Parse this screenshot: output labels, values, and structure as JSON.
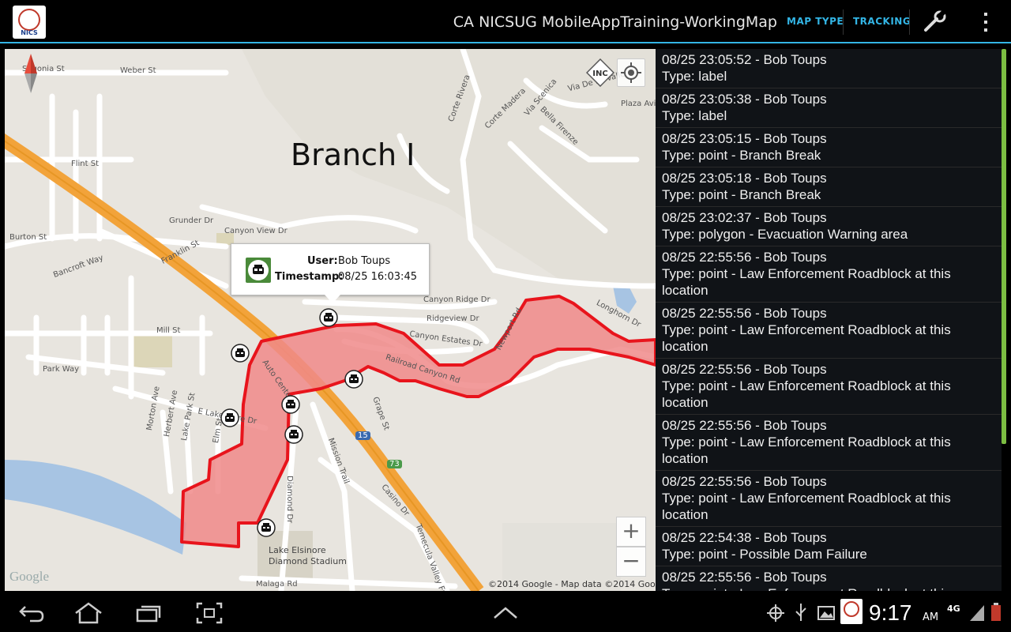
{
  "header": {
    "app_logo_text": "NICS",
    "title": "CA NICSUG MobileAppTraining-WorkingMap",
    "map_type_label": "MAP TYPE",
    "tracking_label": "TRACKING"
  },
  "map": {
    "branch_label": "Branch I",
    "inc_label": "INC",
    "zoom_in": "+",
    "zoom_out": "−",
    "google": "Google",
    "copyright": "©2014 Google - Map data ©2014 Google",
    "stadium": "Lake Elsinore\nDiamond Stadium",
    "streets": {
      "weber": "Weber St",
      "segonia": "Segonia St",
      "flint": "Flint St",
      "burton": "Burton St",
      "bancroft": "Bancroft Way",
      "franklin": "Franklin St",
      "grunder": "Grunder Dr",
      "canyon_view": "Canyon View Dr",
      "mill": "Mill St",
      "park_way": "Park Way",
      "e_lakeshore": "E Lakeshore Dr",
      "morton": "Morton Ave",
      "herbert": "Herbert Ave",
      "lake_park": "Lake Park St",
      "elm": "Elm St",
      "canyon_ridge": "Canyon Ridge Dr",
      "ridgeview": "Ridgeview Dr",
      "canyon_estates": "Canyon Estates Dr",
      "railroad": "Railroad Canyon Rd",
      "newport": "Newport Rd",
      "longhorn": "Longhorn Dr",
      "grape": "Grape St",
      "mission": "Mission Trail",
      "casino": "Casino Dr",
      "diamond": "Diamond Dr",
      "malaga": "Malaga Rd",
      "temecula": "Temecula Valley Fwy",
      "corte_rivera": "Corte Rivera",
      "corte_madera": "Corte Madera",
      "via_scenica": "Via Scenica",
      "bella_firenze": "Bella Firenze",
      "plaza": "Plaza Avil",
      "via_de_la_valle": "Via De La Valle",
      "auto_center": "Auto Center Dr",
      "hwy15": "15",
      "hwy73": "73"
    },
    "info_window": {
      "user_label": "User:",
      "user_value": "Bob Toups",
      "timestamp_label": "Timestamp:",
      "timestamp_value": "08/25 16:03:45"
    }
  },
  "list": [
    {
      "line1": "08/25 23:05:52 - Bob Toups",
      "line2": "Type: label"
    },
    {
      "line1": "08/25 23:05:38 - Bob Toups",
      "line2": "Type: label"
    },
    {
      "line1": "08/25 23:05:15 - Bob Toups",
      "line2": "Type: point - Branch Break"
    },
    {
      "line1": "08/25 23:05:18 - Bob Toups",
      "line2": "Type: point - Branch Break"
    },
    {
      "line1": "08/25 23:02:37 - Bob Toups",
      "line2": "Type: polygon - Evacuation Warning area"
    },
    {
      "line1": "08/25 22:55:56 - Bob Toups",
      "line2": "Type: point - Law Enforcement Roadblock at this location"
    },
    {
      "line1": "08/25 22:55:56 - Bob Toups",
      "line2": "Type: point - Law Enforcement Roadblock at this location"
    },
    {
      "line1": "08/25 22:55:56 - Bob Toups",
      "line2": "Type: point - Law Enforcement Roadblock at this location"
    },
    {
      "line1": "08/25 22:55:56 - Bob Toups",
      "line2": "Type: point - Law Enforcement Roadblock at this location"
    },
    {
      "line1": "08/25 22:55:56 - Bob Toups",
      "line2": "Type: point - Law Enforcement Roadblock at this location"
    },
    {
      "line1": "08/25 22:54:38 - Bob Toups",
      "line2": "Type: point - Possible Dam Failure"
    },
    {
      "line1": "08/25 22:55:56 - Bob Toups",
      "line2": "Type: point - Law Enforcement Roadblock at this location"
    }
  ],
  "status": {
    "time": "9:17",
    "ampm": "AM",
    "network": "4G",
    "colors": {
      "accent": "#33b5e5",
      "polygon_stroke": "#e8141c",
      "polygon_fill": "#f08a8a",
      "freeway": "#f0a030",
      "scrollbar": "#7cbd42"
    }
  }
}
